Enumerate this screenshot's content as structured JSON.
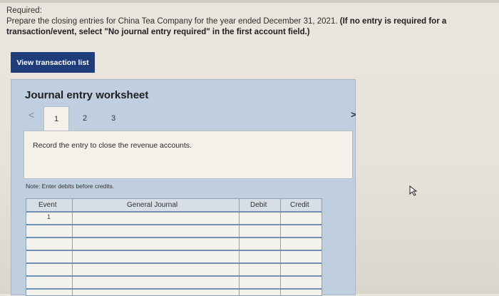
{
  "required": {
    "heading": "Required:",
    "text_prefix": "Prepare the closing entries for China Tea Company for the year ended December 31, 2021.",
    "text_bold": "(If no entry is required for a transaction/event, select \"No journal entry required\" in the first account field.)"
  },
  "view_button": {
    "label": "View transaction list"
  },
  "worksheet": {
    "title": "Journal entry worksheet",
    "tabs": [
      "1",
      "2",
      "3"
    ],
    "prev_label": "<",
    "next_label": ">",
    "task": "Record the entry to close the revenue accounts.",
    "note": "Note: Enter debits before credits."
  },
  "journal": {
    "headers": {
      "event": "Event",
      "general_journal": "General Journal",
      "debit": "Debit",
      "credit": "Credit"
    },
    "first_event": "1"
  },
  "colors": {
    "button_bg": "#1f3d7a",
    "worksheet_bg": "#bfcfe0",
    "table_lines": "#6f8fb4"
  }
}
